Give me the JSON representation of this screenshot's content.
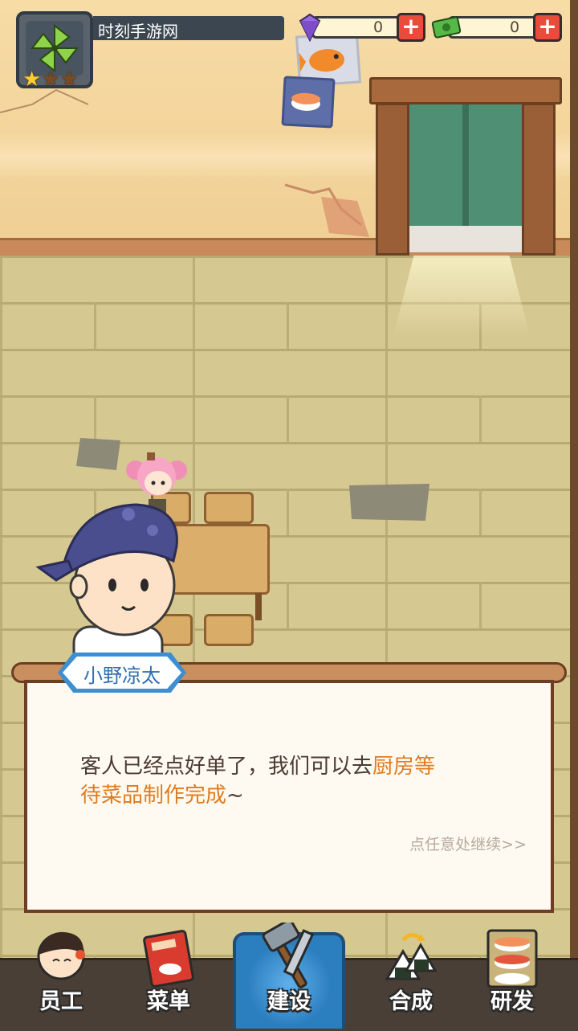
{
  "hud": {
    "player_name": "时刻手游网",
    "stars_total": 3,
    "stars_filled": 1,
    "gems": "0",
    "cash": "0",
    "plus_label": "+"
  },
  "dialog": {
    "speaker": "小野凉太",
    "line1_plain": "客人已经点好单了，我们可以去",
    "line1_highlight": "厨房等",
    "line2_highlight": "待菜品制作完成",
    "line2_plain": "~",
    "continue_hint": "点任意处继续>>"
  },
  "nav": {
    "items": [
      {
        "label": "员工",
        "icon": "staff-icon"
      },
      {
        "label": "菜单",
        "icon": "menu-book-icon"
      },
      {
        "label": "建设",
        "icon": "hammer-saw-icon",
        "active": true
      },
      {
        "label": "合成",
        "icon": "onigiri-merge-icon"
      },
      {
        "label": "研发",
        "icon": "sushi-research-icon"
      }
    ]
  },
  "colors": {
    "accent_blue": "#2c7fbf",
    "highlight_orange": "#e07b1e",
    "plus_red": "#ea4b3a"
  }
}
